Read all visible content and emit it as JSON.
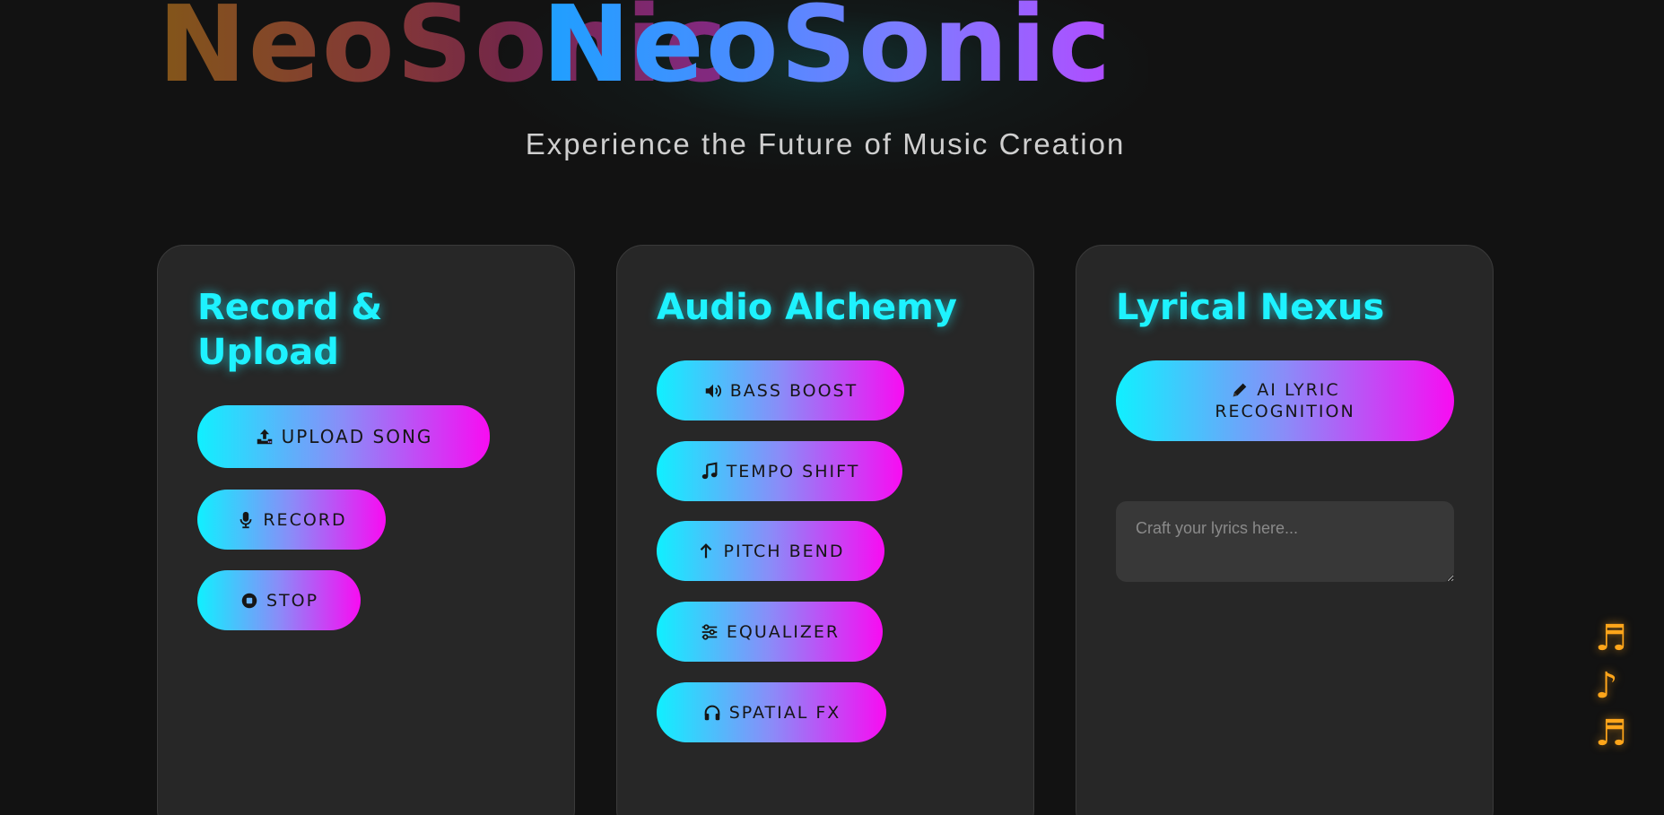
{
  "app": {
    "logo_ghost": "NeoSonic",
    "logo_main": "NeoSonic",
    "tagline": "Experience the Future of Music Creation",
    "accent_cyan": "#1ef2ff",
    "accent_magenta": "#f80cf2",
    "note_color": "#ffa51a"
  },
  "record_card": {
    "title_line1": "Record &",
    "title_line2": "Upload",
    "buttons": [
      {
        "label": "UPLOAD SONG",
        "icon": "upload-icon"
      },
      {
        "label": "RECORD",
        "icon": "microphone-icon"
      },
      {
        "label": "STOP",
        "icon": "stop-icon"
      }
    ]
  },
  "alchemy_card": {
    "title": "Audio Alchemy",
    "buttons": [
      {
        "label": "BASS BOOST",
        "icon": "volume-icon"
      },
      {
        "label": "TEMPO SHIFT",
        "icon": "music-note-icon"
      },
      {
        "label": "PITCH BEND",
        "icon": "arrow-up-icon"
      },
      {
        "label": "EQUALIZER",
        "icon": "sliders-icon"
      },
      {
        "label": "SPATIAL FX",
        "icon": "headphones-icon"
      }
    ]
  },
  "lyrics_card": {
    "title": "Lyrical Nexus",
    "ai_button_line1": "AI LYRIC",
    "ai_button_line2": "RECOGNITION",
    "ai_button_icon": "pen-icon",
    "textarea_placeholder": "Craft your lyrics here...",
    "textarea_value": ""
  },
  "floating_notes": [
    "♬",
    "♪",
    "♬"
  ]
}
